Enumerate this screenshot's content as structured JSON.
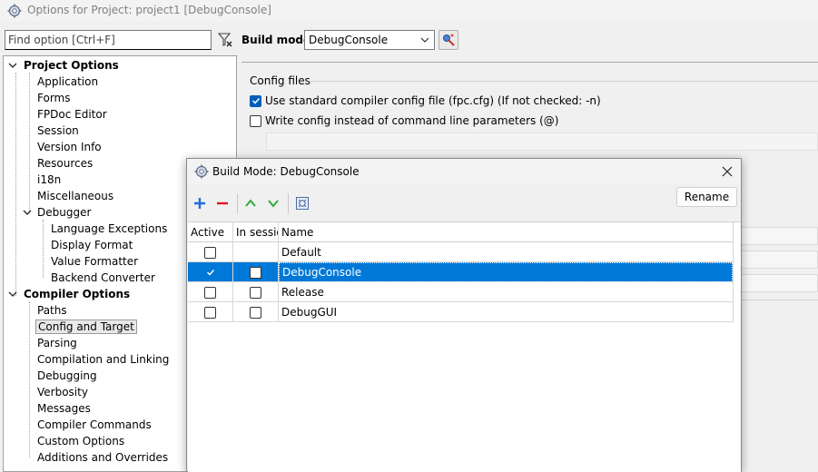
{
  "window": {
    "title": "Options for Project: project1 [DebugConsole]"
  },
  "search": {
    "placeholder": "Find option [Ctrl+F]"
  },
  "build_mode": {
    "label": "Build mode",
    "selected": "DebugConsole"
  },
  "tree": {
    "groups": [
      {
        "label": "Project Options",
        "items": [
          "Application",
          "Forms",
          "FPDoc Editor",
          "Session",
          "Version Info",
          "Resources",
          "i18n",
          "Miscellaneous"
        ]
      },
      {
        "label": "Debugger",
        "items": [
          "Language Exceptions",
          "Display Format",
          "Value Formatter",
          "Backend Converter"
        ]
      },
      {
        "label": "Compiler Options",
        "items": [
          "Paths",
          "Config and Target",
          "Parsing",
          "Compilation and Linking",
          "Debugging",
          "Verbosity",
          "Messages",
          "Compiler Commands",
          "Custom Options",
          "Additions and Overrides"
        ]
      }
    ],
    "selected": "Config and Target"
  },
  "config_files": {
    "title": "Config files",
    "use_standard": {
      "label": "Use standard compiler config file (fpc.cfg) (If not checked: -n)",
      "checked": true
    },
    "write_config": {
      "label": "Write config instead of command line parameters (@)",
      "checked": false
    }
  },
  "dialog": {
    "title": "Build Mode: DebugConsole",
    "rename_label": "Rename",
    "columns": [
      "Active",
      "In sessio",
      "Name"
    ],
    "rows": [
      {
        "name": "Default",
        "active": false,
        "in_session": null,
        "selected": false
      },
      {
        "name": "DebugConsole",
        "active": true,
        "in_session": false,
        "selected": true
      },
      {
        "name": "Release",
        "active": false,
        "in_session": false,
        "selected": false
      },
      {
        "name": "DebugGUI",
        "active": false,
        "in_session": false,
        "selected": false
      }
    ]
  },
  "colors": {
    "accent": "#0078d7",
    "check": "#005fb8",
    "add": "#1e6fd9",
    "remove": "#e81123",
    "arrows": "#2eaa3c"
  }
}
